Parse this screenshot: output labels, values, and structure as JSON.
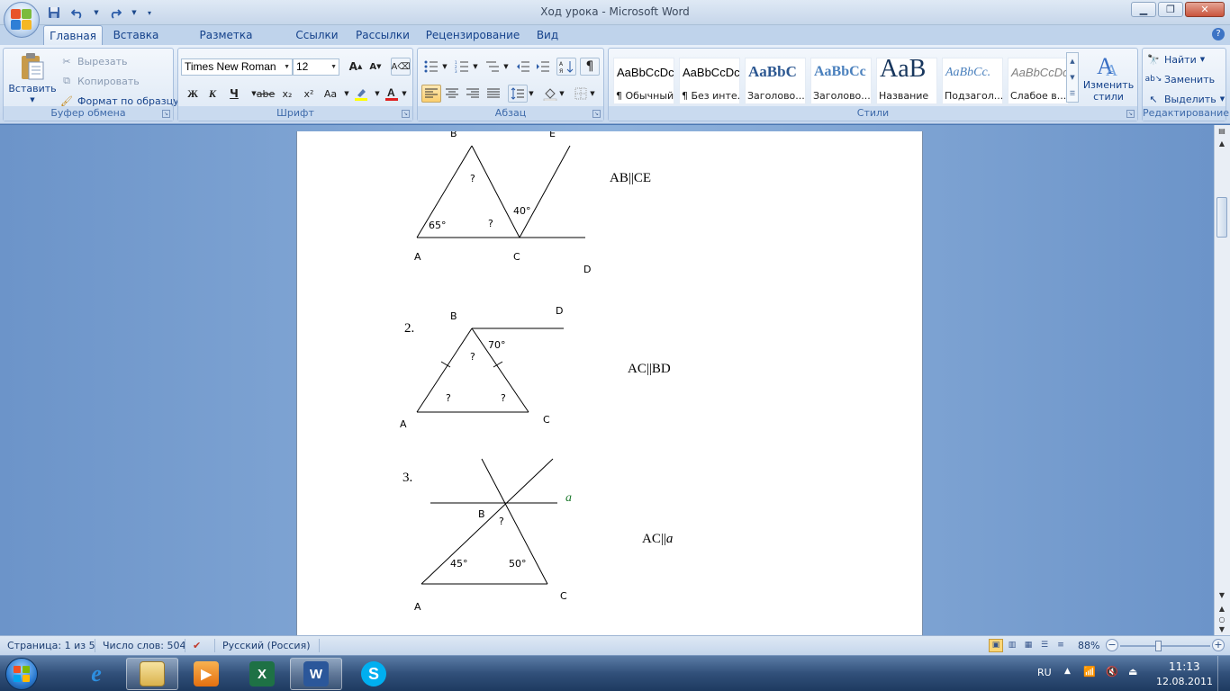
{
  "window": {
    "title": "Ход урока - Microsoft Word",
    "minimize_icon": "minimize-icon",
    "maximize_icon": "restore-icon",
    "close_icon": "close-icon"
  },
  "quick_access": [
    "save-icon",
    "undo-icon",
    "redo-icon",
    "customize-icon"
  ],
  "tabs": [
    "Главная",
    "Вставка",
    "Разметка страницы",
    "Ссылки",
    "Рассылки",
    "Рецензирование",
    "Вид"
  ],
  "active_tab": "Главная",
  "ribbon": {
    "clipboard": {
      "label": "Буфер обмена",
      "paste": "Вставить",
      "cut": "Вырезать",
      "copy": "Копировать",
      "format_painter": "Формат по образцу"
    },
    "font": {
      "label": "Шрифт",
      "font_name": "Times New Roman",
      "font_size": "12",
      "bold": "Ж",
      "italic": "К",
      "underline": "Ч",
      "strike": "abe",
      "sub": "x₂",
      "sup": "x²",
      "case": "Aa"
    },
    "paragraph": {
      "label": "Абзац",
      "pilcrow": "¶"
    },
    "styles": {
      "label": "Стили",
      "tiles": [
        {
          "preview": "AaBbCcDc",
          "name": "¶ Обычный"
        },
        {
          "preview": "AaBbCcDc",
          "name": "¶ Без инте..."
        },
        {
          "preview": "AaBbC",
          "name": "Заголово..."
        },
        {
          "preview": "AaBbCc",
          "name": "Заголово..."
        },
        {
          "preview": "AaB",
          "name": "Название"
        },
        {
          "preview": "AaBbCc.",
          "name": "Подзагол..."
        },
        {
          "preview": "AaBbCcDc",
          "name": "Слабое в..."
        }
      ],
      "change_styles_line1": "Изменить",
      "change_styles_line2": "стили"
    },
    "editing": {
      "label": "Редактирование",
      "find": "Найти",
      "replace": "Заменить",
      "select": "Выделить"
    }
  },
  "document": {
    "fig1": {
      "B": "B",
      "E": "E",
      "A": "A",
      "C": "C",
      "D": "D",
      "angleA": "65°",
      "angleB": "?",
      "angleC": "?",
      "angleECD": "40°",
      "relation": "AB||CE"
    },
    "fig2": {
      "number": "2.",
      "B": "B",
      "D": "D",
      "A": "A",
      "C": "C",
      "angleDB": "70°",
      "angleB": "?",
      "angleA": "?",
      "angleC": "?",
      "relation": "AC||BD"
    },
    "fig3": {
      "number": "3.",
      "B": "B",
      "a": "a",
      "A": "A",
      "C": "C",
      "angleB": "?",
      "angleA": "45°",
      "angleC": "50°",
      "relation_main": "AC||",
      "relation_a": "a"
    }
  },
  "statusbar": {
    "page": "Страница: 1 из 5",
    "words": "Число слов: 504",
    "language": "Русский (Россия)",
    "zoom": "88%",
    "zoom_value_percent": 88
  },
  "taskbar": {
    "apps": [
      "internet-explorer",
      "windows-explorer",
      "media-player",
      "excel",
      "word",
      "skype"
    ],
    "active_app": "word",
    "tray_lang": "RU",
    "time": "11:13",
    "date": "12.08.2011"
  },
  "colors": {
    "ribbon_accent": "#15428b",
    "word_blue": "#2b579a",
    "excel_green": "#1e7145",
    "skype_blue": "#00aff0"
  }
}
